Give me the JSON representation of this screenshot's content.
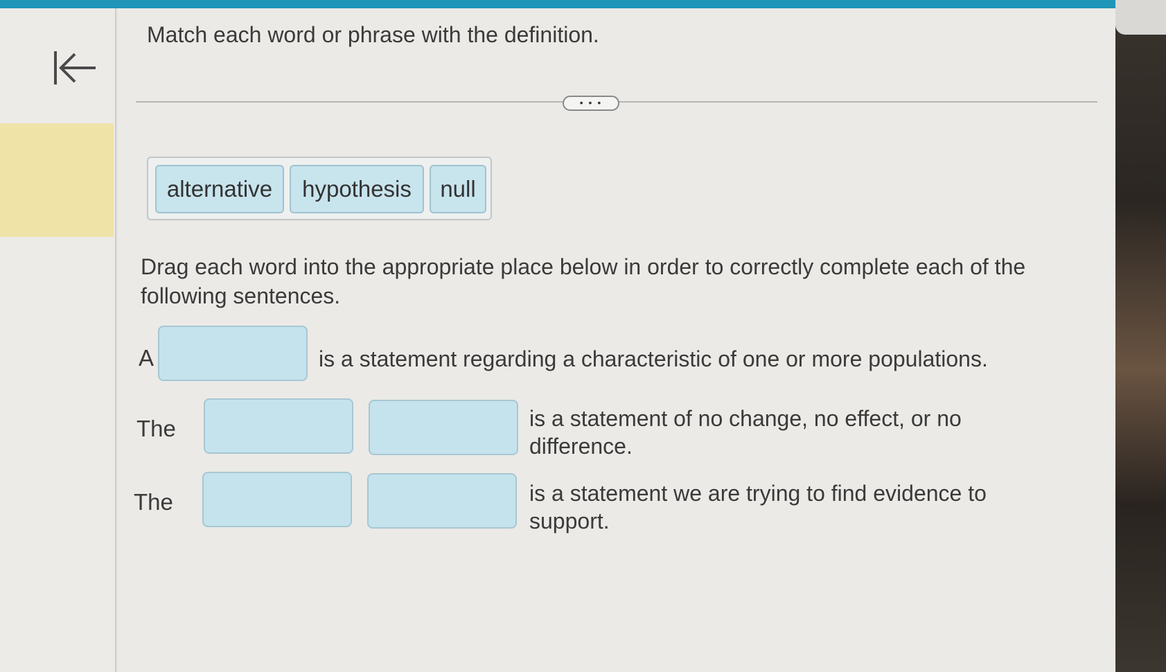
{
  "header": {
    "title": "Match each word or phrase with the definition.",
    "more_label": "• • •"
  },
  "nav": {
    "back_icon": "collapse-left-arrow-icon"
  },
  "word_bank": {
    "chips": [
      {
        "label": "alternative"
      },
      {
        "label": "hypothesis"
      },
      {
        "label": "null"
      }
    ]
  },
  "instructions": "Drag each word into the appropriate place below in order to correctly complete each of the following sentences.",
  "sentences": [
    {
      "prefix": "A",
      "blanks": 1,
      "text": "is a statement regarding a characteristic of one or more populations."
    },
    {
      "prefix": "The",
      "blanks": 2,
      "text": "is a statement of no change, no effect, or no difference."
    },
    {
      "prefix": "The",
      "blanks": 2,
      "text": "is a statement we are trying to find evidence to support."
    }
  ],
  "colors": {
    "top_bar": "#1f95b8",
    "chip_fill": "#c8e4ed",
    "drop_fill": "#c5e3ed",
    "accent_block": "#efe3a8"
  }
}
